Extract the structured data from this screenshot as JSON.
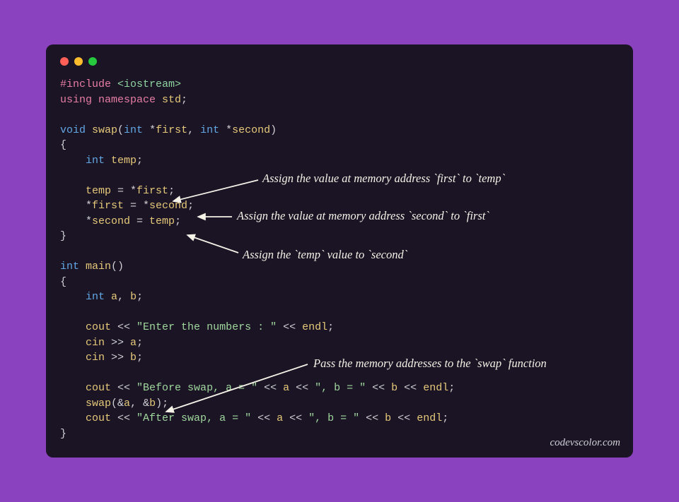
{
  "window": {
    "traffic_lights": [
      "red",
      "yellow",
      "green"
    ]
  },
  "code": {
    "l01_include": "#include",
    "l01_header": " <iostream>",
    "l02_using": "using",
    "l02_namespace": " namespace",
    "l02_std": " std",
    "l02_semi": ";",
    "l04_void": "void",
    "l04_swap": " swap",
    "l04_paren_o": "(",
    "l04_int1": "int",
    "l04_star1": " *",
    "l04_first": "first",
    "l04_comma": ", ",
    "l04_int2": "int",
    "l04_star2": " *",
    "l04_second": "second",
    "l04_paren_c": ")",
    "l05_brace_o": "{",
    "l06_indent": "    ",
    "l06_int": "int",
    "l06_temp": " temp",
    "l06_semi": ";",
    "l08_indent": "    ",
    "l08_temp": "temp",
    "l08_eq": " = *",
    "l08_first": "first",
    "l08_semi": ";",
    "l09_indent": "    *",
    "l09_first": "first",
    "l09_eq": " = *",
    "l09_second": "second",
    "l09_semi": ";",
    "l10_indent": "    *",
    "l10_second": "second",
    "l10_eq": " = ",
    "l10_temp": "temp",
    "l10_semi": ";",
    "l11_brace_c": "}",
    "l13_int": "int",
    "l13_main": " main",
    "l13_parens": "()",
    "l14_brace_o": "{",
    "l15_indent": "    ",
    "l15_int": "int",
    "l15_a": " a",
    "l15_comma": ", ",
    "l15_b": "b",
    "l15_semi": ";",
    "l17_indent": "    ",
    "l17_cout": "cout",
    "l17_op1": " << ",
    "l17_str": "\"Enter the numbers : \"",
    "l17_op2": " << ",
    "l17_endl": "endl",
    "l17_semi": ";",
    "l18_indent": "    ",
    "l18_cin": "cin",
    "l18_op": " >> ",
    "l18_a": "a",
    "l18_semi": ";",
    "l19_indent": "    ",
    "l19_cin": "cin",
    "l19_op": " >> ",
    "l19_b": "b",
    "l19_semi": ";",
    "l21_indent": "    ",
    "l21_cout": "cout",
    "l21_op1": " << ",
    "l21_str1": "\"Before swap, a = \"",
    "l21_op2": " << ",
    "l21_a": "a",
    "l21_op3": " << ",
    "l21_str2": "\", b = \"",
    "l21_op4": " << ",
    "l21_b": "b",
    "l21_op5": " << ",
    "l21_endl": "endl",
    "l21_semi": ";",
    "l22_indent": "    ",
    "l22_swap": "swap",
    "l22_paren_o": "(&",
    "l22_a": "a",
    "l22_comma": ", &",
    "l22_b": "b",
    "l22_paren_c": ");",
    "l23_indent": "    ",
    "l23_cout": "cout",
    "l23_op1": " << ",
    "l23_str1": "\"After swap, a = \"",
    "l23_op2": " << ",
    "l23_a": "a",
    "l23_op3": " << ",
    "l23_str2": "\", b = \"",
    "l23_op4": " << ",
    "l23_b": "b",
    "l23_op5": " << ",
    "l23_endl": "endl",
    "l23_semi": ";",
    "l24_brace_c": "}"
  },
  "annotations": {
    "a1": "Assign the value at memory address `first` to `temp`",
    "a2": "Assign the value at memory address `second` to `first`",
    "a3": "Assign the `temp` value to `second`",
    "a4": "Pass the memory addresses to the `swap` function"
  },
  "watermark": "codevscolor.com"
}
